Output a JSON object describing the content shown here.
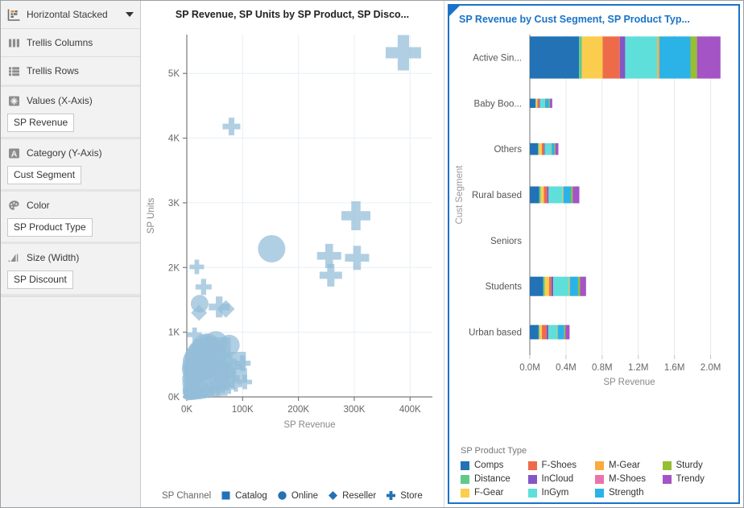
{
  "sidebar": {
    "shelves": [
      {
        "icon": "chart-type-icon",
        "label": "Horizontal Stacked",
        "has_caret": true,
        "chip": null
      },
      {
        "icon": "trellis-columns-icon",
        "label": "Trellis Columns",
        "has_caret": false,
        "chip": null
      },
      {
        "icon": "trellis-rows-icon",
        "label": "Trellis Rows",
        "has_caret": false,
        "chip": null
      },
      {
        "icon": "values-grid-icon",
        "label": "Values (X-Axis)",
        "has_caret": false,
        "chip": "SP Revenue"
      },
      {
        "icon": "attribute-a-icon",
        "label": "Category (Y-Axis)",
        "has_caret": false,
        "chip": "Cust Segment"
      },
      {
        "icon": "palette-icon",
        "label": "Color",
        "has_caret": false,
        "chip": "SP Product Type"
      },
      {
        "icon": "size-width-icon",
        "label": "Size (Width)",
        "has_caret": false,
        "chip": "SP Discount"
      }
    ]
  },
  "left_panel": {
    "title": "SP Revenue, SP Units by SP Product, SP Disco...",
    "legend_caption": "SP Channel",
    "legend_items": [
      {
        "label": "Catalog",
        "shape": "square"
      },
      {
        "label": "Online",
        "shape": "circle"
      },
      {
        "label": "Reseller",
        "shape": "diamond"
      },
      {
        "label": "Store",
        "shape": "cross"
      }
    ],
    "marker_color": "#93bcd8",
    "legend_marker_color": "#2272b5"
  },
  "right_panel": {
    "title": "SP Revenue by Cust Segment, SP Product Typ...",
    "accent_color": "#1a73c8",
    "legend_caption": "SP Product Type"
  },
  "chart_data": [
    {
      "type": "scatter",
      "title": "SP Revenue, SP Units by SP Product, SP Disco...",
      "xlabel": "SP Revenue",
      "ylabel": "SP Units",
      "xlim": [
        0,
        440000
      ],
      "ylim": [
        0,
        5600
      ],
      "xticks": [
        0,
        100000,
        200000,
        300000,
        400000
      ],
      "xticklabels": [
        "0K",
        "100K",
        "200K",
        "300K",
        "400K"
      ],
      "yticks": [
        0,
        1000,
        2000,
        3000,
        4000,
        5000
      ],
      "yticklabels": [
        "0K",
        "1K",
        "2K",
        "3K",
        "4K",
        "5K"
      ],
      "grid": true,
      "legend_title": "SP Channel",
      "legend_position": "bottom",
      "series": [
        {
          "name": "Catalog",
          "shape": "square"
        },
        {
          "name": "Online",
          "shape": "circle"
        },
        {
          "name": "Reseller",
          "shape": "diamond"
        },
        {
          "name": "Store",
          "shape": "cross"
        }
      ],
      "points": [
        {
          "x": 388000,
          "y": 5320,
          "size": 44,
          "shape": "cross"
        },
        {
          "x": 80000,
          "y": 4180,
          "size": 22,
          "shape": "cross"
        },
        {
          "x": 303000,
          "y": 2800,
          "size": 36,
          "shape": "cross"
        },
        {
          "x": 255000,
          "y": 2180,
          "size": 30,
          "shape": "cross"
        },
        {
          "x": 305000,
          "y": 2150,
          "size": 30,
          "shape": "cross"
        },
        {
          "x": 258000,
          "y": 1880,
          "size": 28,
          "shape": "cross"
        },
        {
          "x": 152000,
          "y": 2290,
          "size": 34,
          "shape": "circle"
        },
        {
          "x": 18000,
          "y": 2010,
          "size": 18,
          "shape": "cross"
        },
        {
          "x": 30000,
          "y": 1700,
          "size": 20,
          "shape": "cross"
        },
        {
          "x": 23000,
          "y": 1440,
          "size": 22,
          "shape": "circle"
        },
        {
          "x": 22000,
          "y": 1300,
          "size": 20,
          "shape": "diamond"
        },
        {
          "x": 58000,
          "y": 1390,
          "size": 26,
          "shape": "cross"
        },
        {
          "x": 70000,
          "y": 1360,
          "size": 22,
          "shape": "diamond"
        },
        {
          "x": 14000,
          "y": 960,
          "size": 18,
          "shape": "cross"
        },
        {
          "x": 52000,
          "y": 830,
          "size": 30,
          "shape": "circle"
        },
        {
          "x": 76000,
          "y": 800,
          "size": 26,
          "shape": "circle"
        },
        {
          "x": 60000,
          "y": 760,
          "size": 26,
          "shape": "square"
        },
        {
          "x": 44000,
          "y": 700,
          "size": 24,
          "shape": "circle"
        },
        {
          "x": 33000,
          "y": 660,
          "size": 22,
          "shape": "circle"
        },
        {
          "x": 90000,
          "y": 560,
          "size": 22,
          "shape": "square"
        },
        {
          "x": 100000,
          "y": 520,
          "size": 20,
          "shape": "cross"
        },
        {
          "x": 84000,
          "y": 470,
          "size": 20,
          "shape": "cross"
        },
        {
          "x": 66000,
          "y": 520,
          "size": 22,
          "shape": "square"
        },
        {
          "x": 48000,
          "y": 470,
          "size": 24,
          "shape": "circle"
        },
        {
          "x": 36000,
          "y": 430,
          "size": 26,
          "shape": "circle"
        },
        {
          "x": 26000,
          "y": 400,
          "size": 24,
          "shape": "circle"
        },
        {
          "x": 20000,
          "y": 350,
          "size": 22,
          "shape": "circle"
        },
        {
          "x": 15000,
          "y": 300,
          "size": 20,
          "shape": "circle"
        },
        {
          "x": 11000,
          "y": 250,
          "size": 18,
          "shape": "circle"
        },
        {
          "x": 8000,
          "y": 200,
          "size": 16,
          "shape": "circle"
        },
        {
          "x": 6000,
          "y": 160,
          "size": 15,
          "shape": "circle"
        },
        {
          "x": 30000,
          "y": 240,
          "size": 20,
          "shape": "square"
        },
        {
          "x": 42000,
          "y": 300,
          "size": 22,
          "shape": "square"
        },
        {
          "x": 54000,
          "y": 330,
          "size": 20,
          "shape": "diamond"
        },
        {
          "x": 24000,
          "y": 180,
          "size": 18,
          "shape": "diamond"
        },
        {
          "x": 17000,
          "y": 140,
          "size": 16,
          "shape": "diamond"
        },
        {
          "x": 12000,
          "y": 110,
          "size": 15,
          "shape": "square"
        },
        {
          "x": 9000,
          "y": 90,
          "size": 14,
          "shape": "circle"
        },
        {
          "x": 5000,
          "y": 70,
          "size": 13,
          "shape": "circle"
        },
        {
          "x": 4000,
          "y": 50,
          "size": 12,
          "shape": "circle"
        },
        {
          "x": 3000,
          "y": 40,
          "size": 12,
          "shape": "square"
        },
        {
          "x": 21000,
          "y": 60,
          "size": 14,
          "shape": "circle"
        },
        {
          "x": 28000,
          "y": 80,
          "size": 15,
          "shape": "circle"
        },
        {
          "x": 35000,
          "y": 100,
          "size": 16,
          "shape": "cross"
        },
        {
          "x": 46000,
          "y": 130,
          "size": 17,
          "shape": "cross"
        },
        {
          "x": 56000,
          "y": 170,
          "size": 18,
          "shape": "square"
        },
        {
          "x": 64000,
          "y": 210,
          "size": 18,
          "shape": "square"
        },
        {
          "x": 72000,
          "y": 260,
          "size": 19,
          "shape": "square"
        },
        {
          "x": 82000,
          "y": 300,
          "size": 18,
          "shape": "cross"
        },
        {
          "x": 95000,
          "y": 330,
          "size": 18,
          "shape": "square"
        },
        {
          "x": 104000,
          "y": 230,
          "size": 18,
          "shape": "cross"
        },
        {
          "x": 88000,
          "y": 180,
          "size": 16,
          "shape": "cross"
        },
        {
          "x": 76000,
          "y": 140,
          "size": 15,
          "shape": "cross"
        },
        {
          "x": 62000,
          "y": 110,
          "size": 15,
          "shape": "square"
        },
        {
          "x": 50000,
          "y": 90,
          "size": 14,
          "shape": "square"
        },
        {
          "x": 40000,
          "y": 70,
          "size": 14,
          "shape": "circle"
        },
        {
          "x": 32000,
          "y": 55,
          "size": 13,
          "shape": "circle"
        },
        {
          "x": 25000,
          "y": 45,
          "size": 13,
          "shape": "circle"
        },
        {
          "x": 19000,
          "y": 35,
          "size": 12,
          "shape": "circle"
        },
        {
          "x": 14000,
          "y": 28,
          "size": 12,
          "shape": "circle"
        },
        {
          "x": 10000,
          "y": 22,
          "size": 11,
          "shape": "circle"
        },
        {
          "x": 7000,
          "y": 18,
          "size": 11,
          "shape": "circle"
        },
        {
          "x": 5500,
          "y": 420,
          "size": 20,
          "shape": "circle"
        },
        {
          "x": 7500,
          "y": 480,
          "size": 22,
          "shape": "circle"
        },
        {
          "x": 10000,
          "y": 560,
          "size": 24,
          "shape": "circle"
        },
        {
          "x": 13000,
          "y": 620,
          "size": 24,
          "shape": "circle"
        },
        {
          "x": 17000,
          "y": 680,
          "size": 24,
          "shape": "circle"
        },
        {
          "x": 22000,
          "y": 720,
          "size": 26,
          "shape": "circle"
        },
        {
          "x": 27000,
          "y": 760,
          "size": 26,
          "shape": "circle"
        },
        {
          "x": 31000,
          "y": 800,
          "size": 28,
          "shape": "circle"
        },
        {
          "x": 38000,
          "y": 820,
          "size": 26,
          "shape": "circle"
        },
        {
          "x": 43000,
          "y": 780,
          "size": 26,
          "shape": "circle"
        },
        {
          "x": 47000,
          "y": 640,
          "size": 24,
          "shape": "square"
        },
        {
          "x": 53000,
          "y": 600,
          "size": 22,
          "shape": "square"
        },
        {
          "x": 58000,
          "y": 560,
          "size": 22,
          "shape": "square"
        },
        {
          "x": 63000,
          "y": 430,
          "size": 20,
          "shape": "square"
        },
        {
          "x": 68000,
          "y": 380,
          "size": 20,
          "shape": "cross"
        },
        {
          "x": 73000,
          "y": 330,
          "size": 20,
          "shape": "cross"
        },
        {
          "x": 2500,
          "y": 120,
          "size": 14,
          "shape": "circle"
        },
        {
          "x": 3500,
          "y": 200,
          "size": 16,
          "shape": "circle"
        },
        {
          "x": 4500,
          "y": 280,
          "size": 18,
          "shape": "circle"
        },
        {
          "x": 6000,
          "y": 340,
          "size": 18,
          "shape": "circle"
        },
        {
          "x": 8500,
          "y": 380,
          "size": 18,
          "shape": "square"
        },
        {
          "x": 11500,
          "y": 420,
          "size": 18,
          "shape": "square"
        },
        {
          "x": 15500,
          "y": 460,
          "size": 18,
          "shape": "square"
        },
        {
          "x": 20000,
          "y": 500,
          "size": 18,
          "shape": "diamond"
        },
        {
          "x": 25000,
          "y": 540,
          "size": 18,
          "shape": "diamond"
        },
        {
          "x": 29000,
          "y": 580,
          "size": 18,
          "shape": "diamond"
        },
        {
          "x": 34000,
          "y": 610,
          "size": 18,
          "shape": "cross"
        },
        {
          "x": 39000,
          "y": 540,
          "size": 18,
          "shape": "cross"
        },
        {
          "x": 45000,
          "y": 500,
          "size": 18,
          "shape": "cross"
        },
        {
          "x": 1500,
          "y": 60,
          "size": 12,
          "shape": "circle"
        },
        {
          "x": 2000,
          "y": 90,
          "size": 13,
          "shape": "circle"
        },
        {
          "x": 2800,
          "y": 30,
          "size": 11,
          "shape": "circle"
        },
        {
          "x": 3200,
          "y": 15,
          "size": 11,
          "shape": "circle"
        }
      ]
    },
    {
      "type": "bar",
      "subtype": "marimekko-horizontal-stacked",
      "title": "SP Revenue by Cust Segment, SP Product Typ...",
      "xlabel": "SP Revenue",
      "ylabel": "Cust Segment",
      "xlim": [
        0,
        2200000
      ],
      "xticks": [
        0,
        400000,
        800000,
        1200000,
        1600000,
        2000000
      ],
      "xticklabels": [
        "0.0M",
        "0.4M",
        "0.8M",
        "1.2M",
        "1.6M",
        "2.0M"
      ],
      "grid": true,
      "legend_title": "SP Product Type",
      "legend_position": "bottom",
      "categories": [
        "Active Sin...",
        "Baby Boo...",
        "Others",
        "Rural based",
        "Seniors",
        "Students",
        "Urban based"
      ],
      "series": [
        {
          "name": "Comps",
          "color": "#2272b5"
        },
        {
          "name": "Distance",
          "color": "#5fc98a"
        },
        {
          "name": "F-Gear",
          "color": "#fbcd4e"
        },
        {
          "name": "F-Shoes",
          "color": "#ee6b4a"
        },
        {
          "name": "InCloud",
          "color": "#8456c4"
        },
        {
          "name": "InGym",
          "color": "#5fdfd9"
        },
        {
          "name": "M-Gear",
          "color": "#f9ab3c"
        },
        {
          "name": "M-Shoes",
          "color": "#ec72ab"
        },
        {
          "name": "Strength",
          "color": "#2bb3e8"
        },
        {
          "name": "Sturdy",
          "color": "#96bf33"
        },
        {
          "name": "Trendy",
          "color": "#a454c4"
        }
      ],
      "values": {
        "Active Sin...": [
          545000,
          30000,
          230000,
          190000,
          60000,
          355000,
          22000,
          0,
          345000,
          72000,
          260000
        ],
        "Baby Boo...": [
          62000,
          7000,
          14000,
          20000,
          9000,
          52000,
          5000,
          0,
          44000,
          9000,
          26000
        ],
        "Others": [
          92000,
          9000,
          32000,
          22000,
          11000,
          70000,
          6000,
          0,
          30000,
          10000,
          34000
        ],
        "Rural based": [
          105000,
          17000,
          34000,
          34000,
          18000,
          155000,
          9000,
          0,
          82000,
          20000,
          74000
        ],
        "Seniors": [
          0,
          0,
          0,
          0,
          0,
          0,
          0,
          0,
          0,
          0,
          0
        ],
        "Students": [
          148000,
          17000,
          49000,
          24000,
          21000,
          175000,
          10000,
          0,
          90000,
          22000,
          66000
        ],
        "Urban based": [
          97000,
          11000,
          26000,
          50000,
          22000,
          96000,
          7000,
          0,
          70000,
          14000,
          47000
        ]
      },
      "bar_widths": {
        "Active Sin...": 1.0,
        "Baby Boo...": 0.22,
        "Others": 0.28,
        "Rural based": 0.4,
        "Seniors": 0.0,
        "Students": 0.46,
        "Urban based": 0.34
      }
    }
  ]
}
